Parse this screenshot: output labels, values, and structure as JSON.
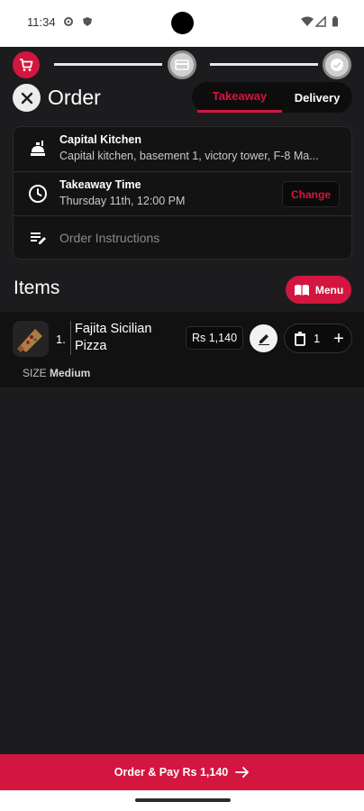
{
  "status_bar": {
    "time": "11:34",
    "icons": [
      "settings-icon",
      "shield-icon",
      "wifi-icon",
      "signal-icon",
      "battery-icon"
    ]
  },
  "stepper": {
    "steps": [
      "cart-icon",
      "card-icon",
      "check-icon"
    ],
    "current_step": 1
  },
  "header": {
    "title": "Order",
    "tabs": [
      {
        "label": "Takeaway",
        "active": true
      },
      {
        "label": "Delivery",
        "active": false
      }
    ]
  },
  "info_card": {
    "restaurant": {
      "title": "Capital Kitchen",
      "address": "Capital kitchen, basement 1, victory tower, F-8 Ma..."
    },
    "time": {
      "title": "Takeaway Time",
      "value": "Thursday 11th, 12:00 PM",
      "change_label": "Change"
    },
    "instructions": {
      "placeholder": "Order Instructions"
    }
  },
  "items_section": {
    "title": "Items",
    "menu_label": "Menu",
    "items": [
      {
        "number": "1.",
        "name": "Fajita Sicilian Pizza",
        "price": "Rs 1,140",
        "quantity": "1",
        "size_label": "SIZE",
        "size_value": "Medium"
      }
    ]
  },
  "cta": {
    "label": "Order & Pay Rs 1,140"
  },
  "colors": {
    "accent": "#d2163f",
    "background": "#1c1c1e",
    "card": "#131313"
  }
}
